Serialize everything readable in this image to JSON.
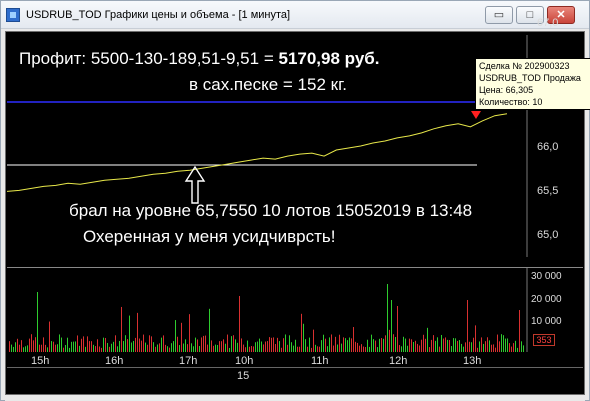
{
  "window": {
    "title": "USDRUB_TOD Графики цены и объема - [1 минута]"
  },
  "price_axis": {
    "ticks": [
      "67,0",
      "66,0",
      "65,5",
      "65,0"
    ]
  },
  "volume_axis": {
    "ticks": [
      "30 000",
      "20 000",
      "10 000"
    ],
    "current_volume": "353"
  },
  "time_axis": {
    "labels": [
      "15h",
      "16h",
      "17h",
      "10h",
      "11h",
      "12h",
      "13h"
    ],
    "date_label": "15"
  },
  "annotations": {
    "profit_prefix": "Профит:  5500-130-189,51-9,51  =",
    "profit_value": "5170,98 руб.",
    "sugar_line": "в сах.песке  =  152 кг.",
    "entry_line": "брал на уровне 65,7550  10 лотов 15052019 в 13:48",
    "comment_line": "Охеренная у меня усидчиврсть!"
  },
  "tooltip": {
    "line1": "Сделка № 202900323",
    "line2": "USDRUB_TOD Продажа",
    "line3": "Цена: 66,305",
    "line4": "Количество: 10"
  },
  "colors": {
    "price_line": "#e8e84a",
    "blue_line": "#2d2dff",
    "level_line": "#ffffff",
    "volume_up": "#2ecc2e",
    "volume_down": "#d93030",
    "sell_marker": "#ff2020"
  },
  "chart_data": {
    "type": "line",
    "series": [
      {
        "values": [
          65.55,
          65.56,
          65.58,
          65.6,
          65.61,
          65.63,
          65.62,
          65.64,
          65.66,
          65.67,
          65.68,
          65.7,
          65.72,
          65.73,
          65.75,
          65.76,
          65.78,
          65.8,
          65.82,
          65.84,
          65.86,
          65.88,
          65.87,
          65.9,
          65.92,
          65.93,
          65.9,
          65.96,
          65.98,
          66.0,
          66.03,
          66.05,
          66.08,
          66.1,
          66.13,
          66.17,
          66.2,
          66.22,
          66.19,
          66.25,
          66.3,
          66.32
        ]
      }
    ],
    "ylim": [
      64.9,
      67.1
    ]
  }
}
